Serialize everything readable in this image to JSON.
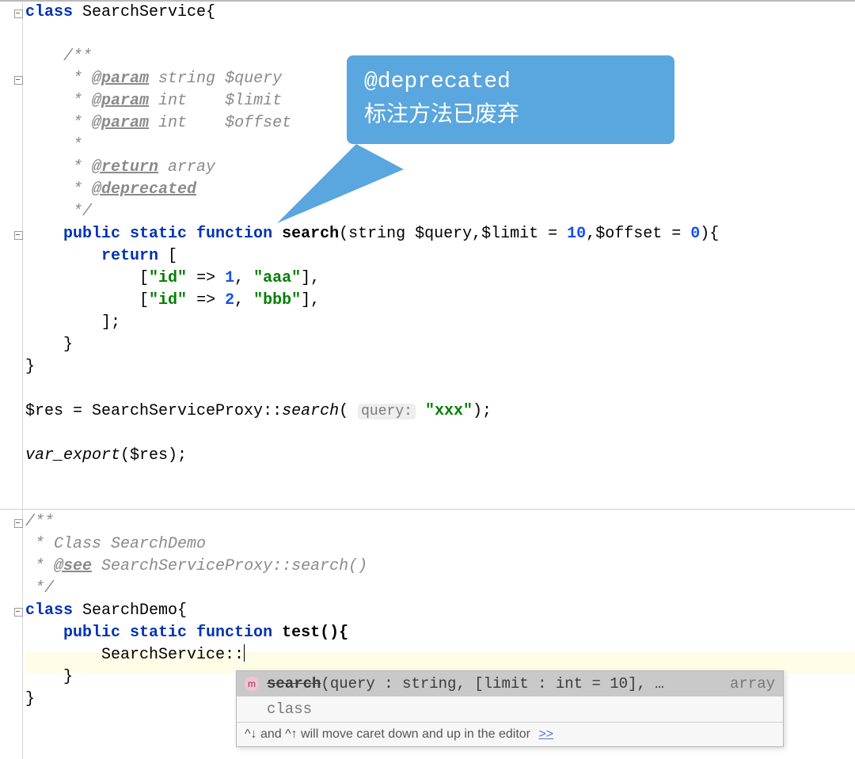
{
  "callout": {
    "line1": "@deprecated",
    "line2": "标注方法已废弃"
  },
  "code": {
    "l1a": "class",
    "l1b": " SearchService{",
    "d_open": "/**",
    "d_p": " * ",
    "d_tag_param": "@param",
    "d_p1_type": " string $query",
    "d_p2_type": " int    $limit",
    "d_p3_type": " int    $offset",
    "d_star": " *",
    "d_tag_ret": "@return",
    "d_ret_t": " array",
    "d_tag_dep": "@deprecated",
    "d_close": " */",
    "fn_kw_pub": "public",
    "fn_kw_static": " static",
    "fn_kw_fn": " function",
    "fn_name": " search",
    "fn_sig_a": "(string ",
    "fn_sig_q": "$query",
    "fn_sig_b": ",",
    "fn_sig_l": "$limit",
    "fn_sig_eq1": " = ",
    "fn_sig_10": "10",
    "fn_sig_c": ",",
    "fn_sig_o": "$offset",
    "fn_sig_eq2": " = ",
    "fn_sig_0": "0",
    "fn_sig_end": "){",
    "ret_kw": "return",
    "ret_open": " [",
    "arr1_a": "[",
    "arr_key": "\"id\"",
    "arr_arrow": " => ",
    "arr_v1": "1",
    "arr_sep": ", ",
    "arr_s1": "\"aaa\"",
    "arr_close": "],",
    "arr_v2": "2",
    "arr_s2": "\"bbb\"",
    "ret_close": "];",
    "res_a": "$res = SearchServiceProxy",
    "res_b": "::",
    "res_call": "search",
    "res_open": "( ",
    "res_hint": "query:",
    "res_sp": " ",
    "res_str": "\"xxx\"",
    "res_end": ");",
    "ve_a": "var_export",
    "ve_b": "($res);",
    "d2_open": "/**",
    "d2_l1": " * Class SearchDemo",
    "d2_see": "@see",
    "d2_see_t": " SearchServiceProxy::search()",
    "d2_close": " */",
    "cl2_a": "class",
    "cl2_b": " SearchDemo{",
    "fn2_a": "public",
    "fn2_b": " static",
    "fn2_c": " function",
    "fn2_d": " test(){",
    "body2": "SearchService::",
    "cb": "}"
  },
  "popup": {
    "row1_name": "search",
    "row1_sig": "(query : string, [limit : int = 10], …",
    "row1_ret": "array",
    "row2": "class",
    "hint_a": "^↓ and ^↑ will move caret down and up in the editor",
    "hint_link": ">>"
  }
}
